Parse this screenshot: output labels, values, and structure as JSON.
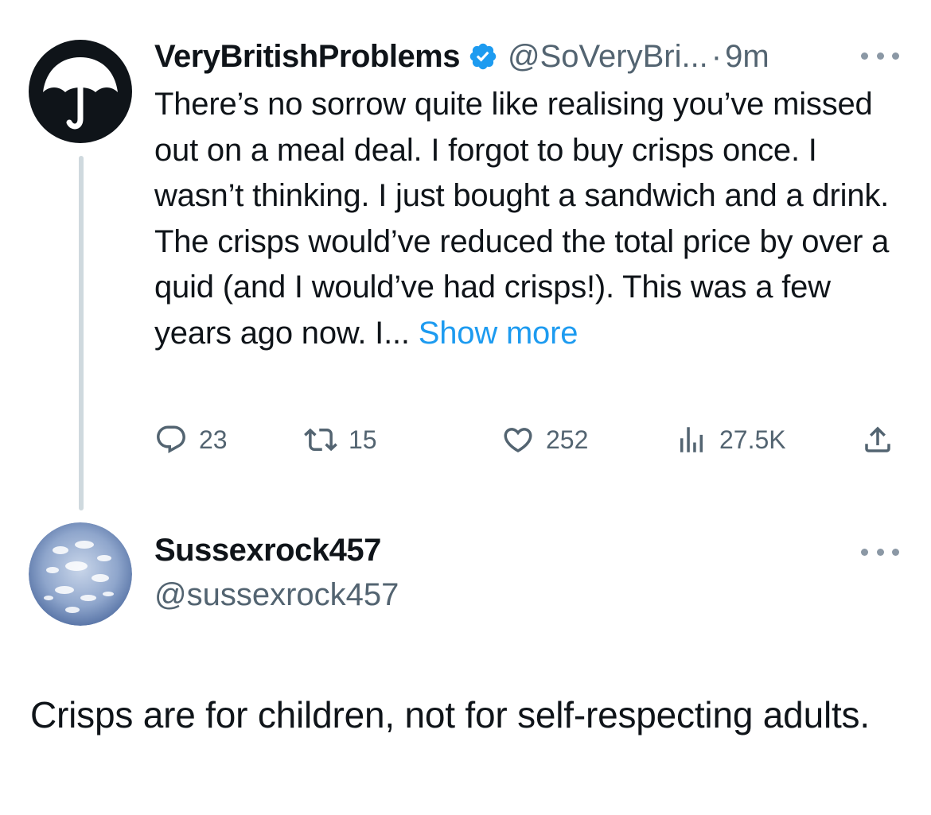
{
  "tweet": {
    "display_name": "VeryBritishProblems",
    "verified": true,
    "handle": "@SoVeryBri...",
    "separator": "·",
    "time": "9m",
    "text": "There’s no sorrow quite like realising you’ve missed out on a meal deal. I forgot to buy crisps once. I wasn’t thinking. I just bought a sandwich and a drink. The crisps would’ve reduced the total price by over a quid (and I would’ve had crisps!). This was a few years ago now. I...",
    "show_more_label": "Show more",
    "stats": {
      "replies": "23",
      "retweets": "15",
      "likes": "252",
      "views": "27.5K"
    },
    "avatar_icon": "umbrella-icon"
  },
  "reply": {
    "display_name": "Sussexrock457",
    "handle": "@sussexrock457",
    "text": "Crisps are for children, not for self-respecting adults.",
    "avatar_icon": "sky-clouds-avatar"
  },
  "colors": {
    "text": "#0f1419",
    "secondary": "#536471",
    "link": "#1d9bf0",
    "verified": "#1d9bf0",
    "thread_line": "#cfd9de"
  }
}
